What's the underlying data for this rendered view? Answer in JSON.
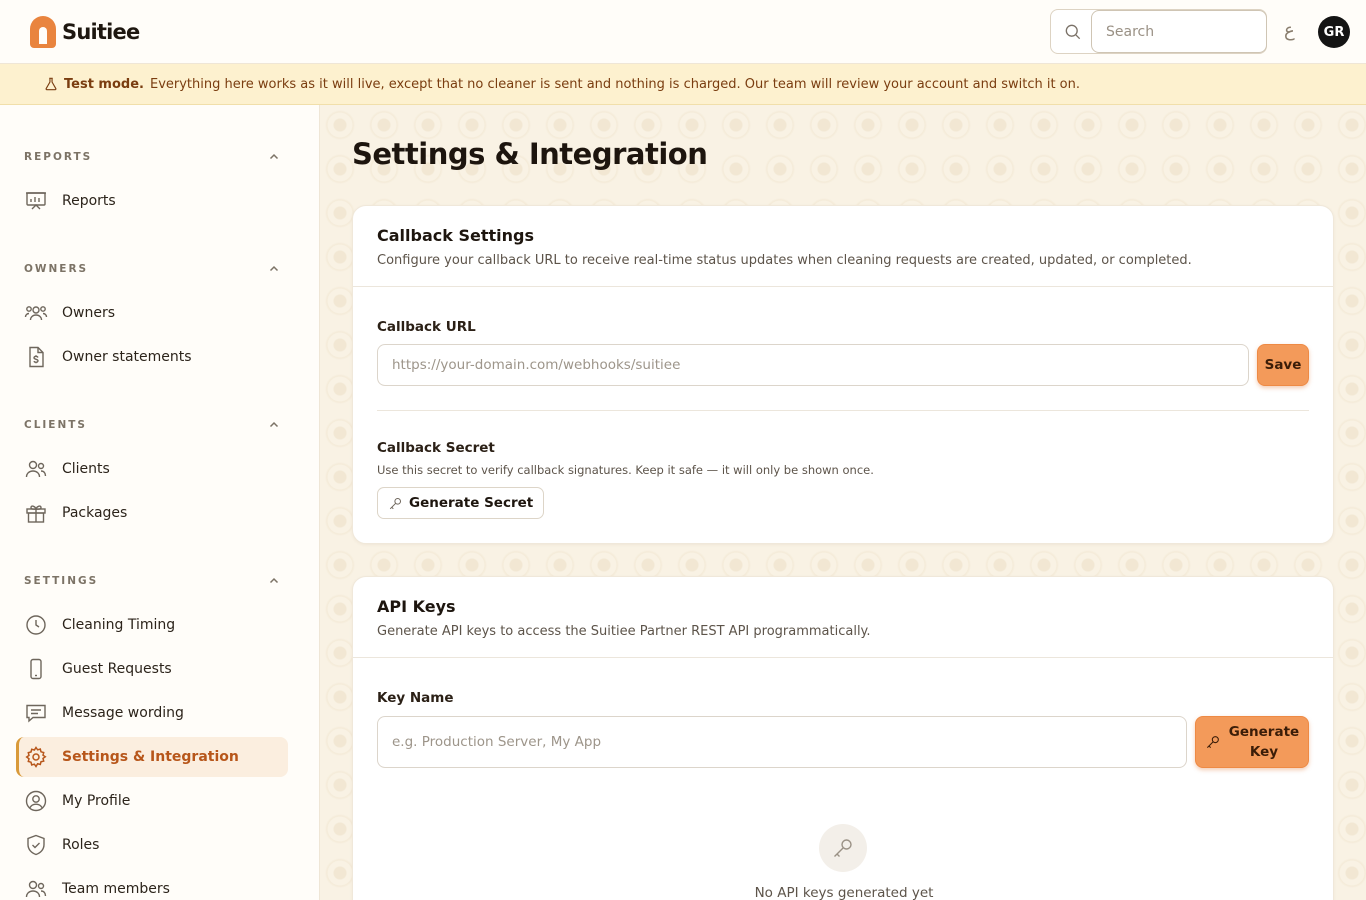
{
  "app": {
    "brand": "Suitiee",
    "avatar_initials": "GR",
    "lang_label": "ع"
  },
  "search": {
    "placeholder": "Search"
  },
  "banner": {
    "label": "Test mode.",
    "message": "Everything here works as it will live, except that no cleaner is sent and nothing is charged. Our team will review your account and switch it on."
  },
  "sidebar": {
    "sections": [
      {
        "title": "REPORTS",
        "items": [
          {
            "label": "Reports",
            "icon": "chart-board-icon"
          }
        ]
      },
      {
        "title": "OWNERS",
        "items": [
          {
            "label": "Owners",
            "icon": "users-group-icon"
          },
          {
            "label": "Owner statements",
            "icon": "dollar-document-icon"
          }
        ]
      },
      {
        "title": "CLIENTS",
        "items": [
          {
            "label": "Clients",
            "icon": "users-icon"
          },
          {
            "label": "Packages",
            "icon": "gift-icon"
          }
        ]
      },
      {
        "title": "SETTINGS",
        "items": [
          {
            "label": "Cleaning Timing",
            "icon": "clock-icon"
          },
          {
            "label": "Guest Requests",
            "icon": "phone-icon"
          },
          {
            "label": "Message wording",
            "icon": "message-icon"
          },
          {
            "label": "Settings & Integration",
            "icon": "gear-icon",
            "active": true
          },
          {
            "label": "My Profile",
            "icon": "user-circle-icon"
          },
          {
            "label": "Roles",
            "icon": "shield-check-icon"
          },
          {
            "label": "Team members",
            "icon": "team-icon"
          }
        ]
      }
    ]
  },
  "main": {
    "title": "Settings & Integration",
    "callback": {
      "title": "Callback Settings",
      "description": "Configure your callback URL to receive real-time status updates when cleaning requests are created, updated, or completed.",
      "url_label": "Callback URL",
      "url_placeholder": "https://your-domain.com/webhooks/suitiee",
      "url_value": "",
      "save_label": "Save",
      "secret_label": "Callback Secret",
      "secret_hint": "Use this secret to verify callback signatures. Keep it safe — it will only be shown once.",
      "generate_secret_label": "Generate Secret"
    },
    "api_keys": {
      "title": "API Keys",
      "description": "Generate API keys to access the Suitiee Partner REST API programmatically.",
      "key_name_label": "Key Name",
      "key_name_placeholder": "e.g. Production Server, My App",
      "key_name_value": "",
      "generate_key_label_line1": "Generate",
      "generate_key_label_line2": "Key",
      "empty_text": "No API keys generated yet"
    }
  },
  "colors": {
    "accent": "#f39a5a",
    "active_text": "#b7561a",
    "banner_bg": "#fdf1cf"
  }
}
